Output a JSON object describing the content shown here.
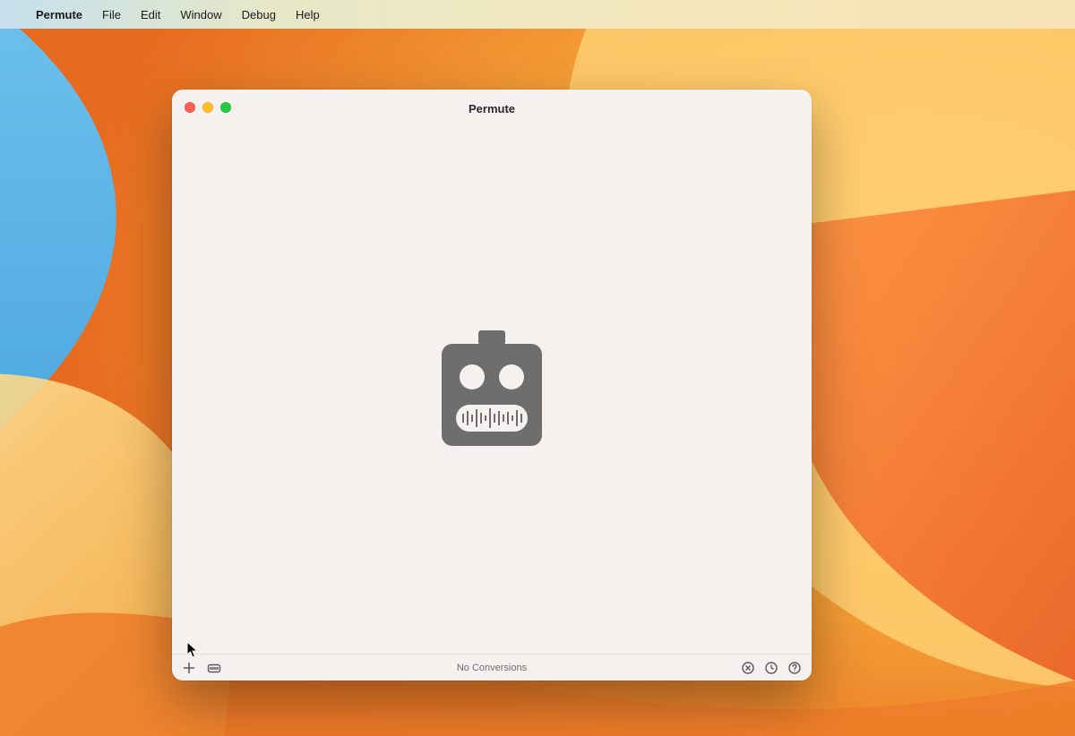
{
  "menubar": {
    "app_name": "Permute",
    "items": [
      "File",
      "Edit",
      "Window",
      "Debug",
      "Help"
    ]
  },
  "window": {
    "title": "Permute"
  },
  "statusbar": {
    "text": "No Conversions"
  }
}
